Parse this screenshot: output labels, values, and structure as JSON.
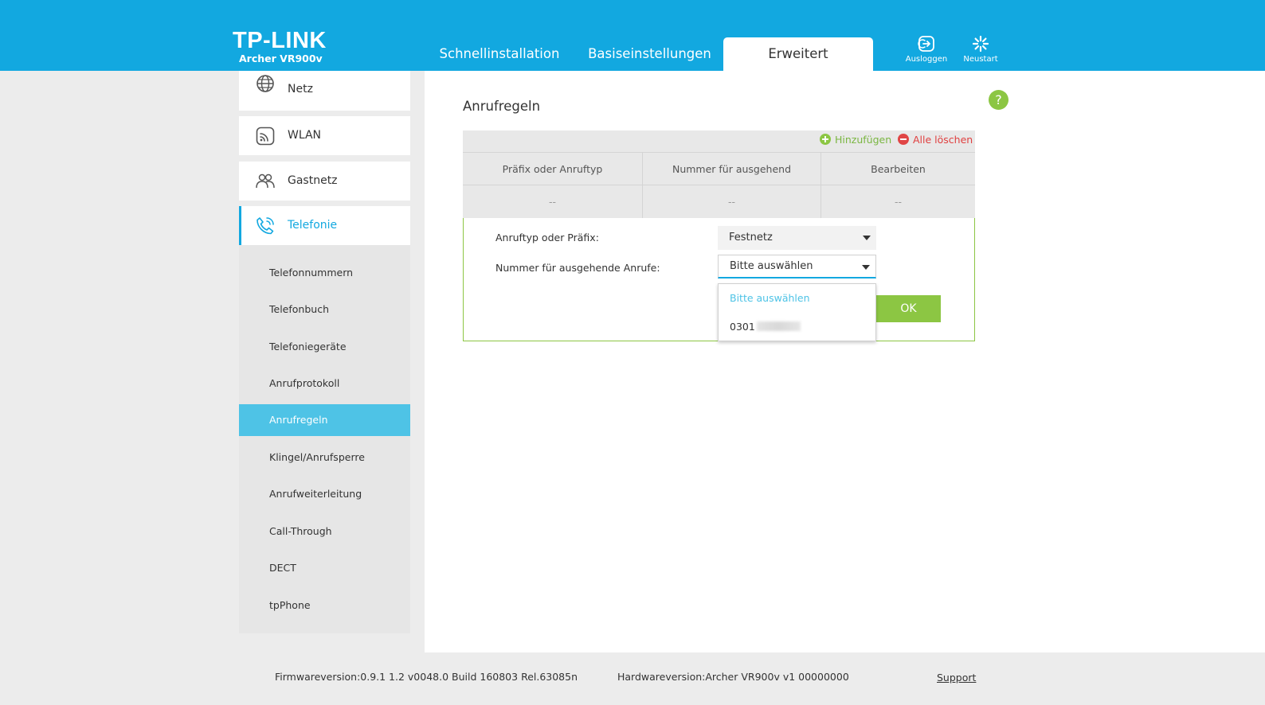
{
  "header": {
    "brand": "TP-LINK",
    "model": "Archer VR900v",
    "tabs": [
      {
        "label": "Schnellinstallation",
        "active": false
      },
      {
        "label": "Basiseinstellungen",
        "active": false
      },
      {
        "label": "Erweitert",
        "active": true
      }
    ],
    "logout_label": "Ausloggen",
    "logout_icon": "logout-icon",
    "reboot_label": "Neustart",
    "reboot_icon": "reboot-icon",
    "color": "#12a8e0"
  },
  "sidebar": {
    "items": [
      {
        "label": "Netz",
        "icon": "globe-icon"
      },
      {
        "label": "WLAN",
        "icon": "wifi-icon"
      },
      {
        "label": "Gastnetz",
        "icon": "guest-network-icon"
      },
      {
        "label": "Telefonie",
        "icon": "phone-icon",
        "active": true
      }
    ],
    "subitems": [
      {
        "label": "Telefonnummern"
      },
      {
        "label": "Telefonbuch"
      },
      {
        "label": "Telefoniegeräte"
      },
      {
        "label": "Anrufprotokoll"
      },
      {
        "label": "Anrufregeln",
        "active": true
      },
      {
        "label": "Klingel/Anrufsperre"
      },
      {
        "label": "Anrufweiterleitung"
      },
      {
        "label": "Call-Through"
      },
      {
        "label": "DECT"
      },
      {
        "label": "tpPhone"
      }
    ],
    "active_color": "#4ec3e6"
  },
  "main": {
    "title": "Anrufregeln",
    "help_label": "?",
    "toolbar": {
      "add_label": "Hinzufügen",
      "delete_all_label": "Alle löschen"
    },
    "table": {
      "columns": [
        "Präfix oder Anruftyp",
        "Nummer für ausgehend",
        "Bearbeiten"
      ],
      "rows": [
        [
          "--",
          "--",
          "--"
        ]
      ]
    },
    "form": {
      "type_label": "Anruftyp oder Präfix:",
      "type_value": "Festnetz",
      "number_label": "Nummer für ausgehende Anrufe:",
      "number_value": "Bitte auswählen",
      "ok_label": "OK",
      "dropdown_options": [
        "Bitte auswählen",
        "0301"
      ]
    },
    "accent_green": "#8cc643",
    "danger_red": "#e04545"
  },
  "footer": {
    "firmware": "Firmwareversion:0.9.1 1.2 v0048.0 Build 160803 Rel.63085n",
    "hardware": "Hardwareversion:Archer VR900v v1 00000000",
    "support_label": "Support"
  }
}
